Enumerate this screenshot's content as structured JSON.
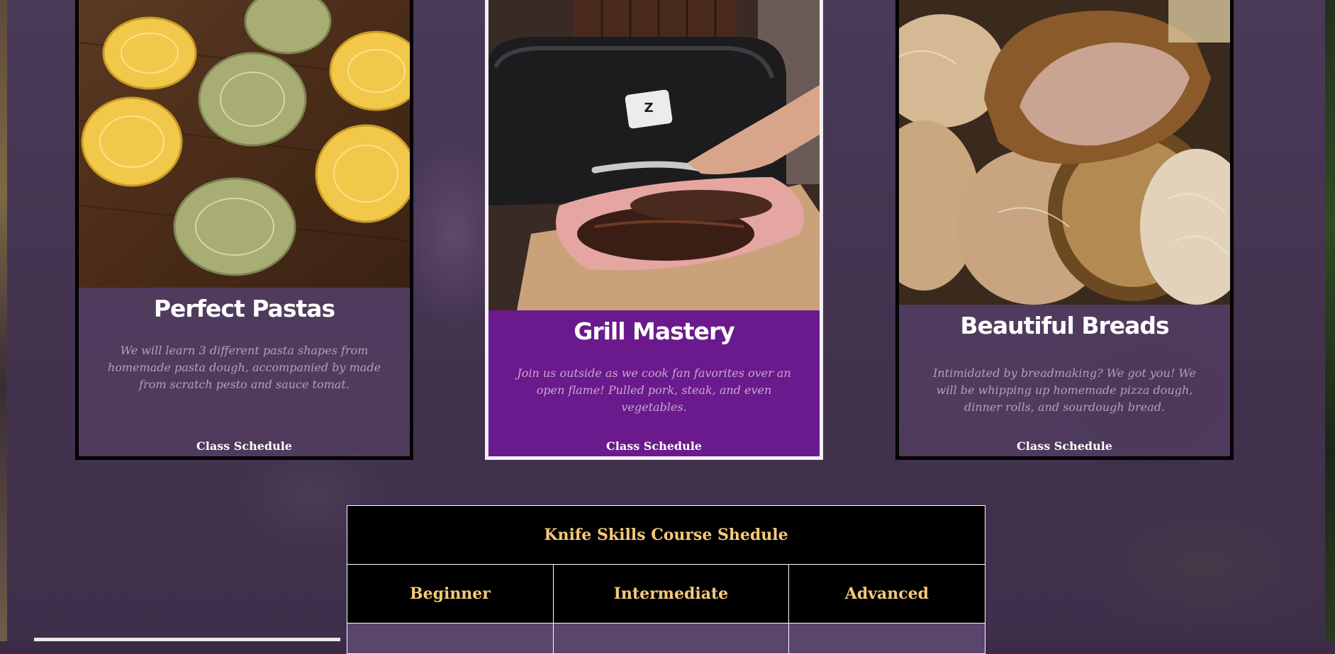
{
  "cards": [
    {
      "title": "Perfect Pastas",
      "description": "We will learn 3 different pasta shapes from homemade pasta dough, accompanied by made from scratch pesto and sauce tomat.",
      "link": "Class Schedule",
      "image": "pasta-nests-photo"
    },
    {
      "title": "Grill Mastery",
      "description": "Join us outside as we cook fan favorites over an open flame! Pulled pork, steak, and even vegetables.",
      "link": "Class Schedule",
      "image": "grill-brisket-photo"
    },
    {
      "title": "Beautiful Breads",
      "description": "Intimidated by breadmaking? We got you! We will be whipping up homemade pizza dough, dinner rolls, and sourdough bread.",
      "link": "Class Schedule",
      "image": "sourdough-loaves-photo"
    }
  ],
  "schedule": {
    "title": "Knife Skills Course Shedule",
    "levels": [
      "Beginner",
      "Intermediate",
      "Advanced"
    ]
  },
  "colors": {
    "accent_purple": "#6a1a8c",
    "heading_gold": "#f5c97a",
    "card_text": "#b69fb5"
  }
}
